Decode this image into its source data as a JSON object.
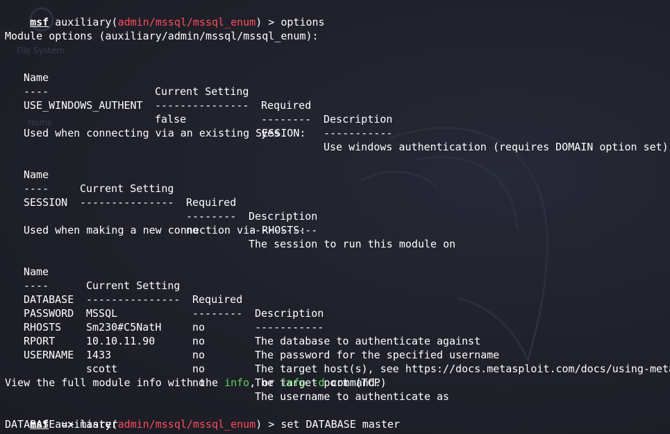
{
  "prompt": {
    "msf": "msf",
    "module_type": "auxiliary",
    "open_paren": "(",
    "module_path": "admin/mssql/mssql_enum",
    "close_paren_arrow": ") >"
  },
  "commands": {
    "first": "options",
    "second": "set DATABASE master"
  },
  "module_options_heading": "Module options (auxiliary/admin/mssql/mssql_enum):",
  "columns": {
    "name": "Name",
    "current": "Current Setting",
    "required": "Required",
    "description": "Description",
    "name_rule": "----",
    "current_rule": "---------------",
    "required_rule": "--------",
    "description_rule": "-----------"
  },
  "module_options": [
    {
      "name": "USE_WINDOWS_AUTHENT",
      "current": "false",
      "required": "yes",
      "description": "Use windows authentication (requires DOMAIN option set)"
    }
  ],
  "session_heading": "Used when connecting via an existing SESSION:",
  "session_options": [
    {
      "name": "SESSION",
      "current": "",
      "required": "no",
      "description": "The session to run this module on"
    }
  ],
  "rhosts_heading": "Used when making a new connection via RHOSTS:",
  "rhosts_options": [
    {
      "name": "DATABASE",
      "current": "MSSQL",
      "required": "no",
      "description": "The database to authenticate against"
    },
    {
      "name": "PASSWORD",
      "current": "Sm230#C5NatH",
      "required": "no",
      "description": "The password for the specified username"
    },
    {
      "name": "RHOSTS",
      "current": "10.10.11.90",
      "required": "no",
      "description": "The target host(s), see https://docs.metasploit.com/docs/using-meta"
    },
    {
      "name": "RPORT",
      "current": "1433",
      "required": "no",
      "description": "The target port (TCP)"
    },
    {
      "name": "USERNAME",
      "current": "scott",
      "required": "no",
      "description": "The username to authenticate as"
    }
  ],
  "footer": {
    "part1": "View the full module info with the ",
    "info": "info",
    "part2": ", or ",
    "info_d": "info -d",
    "part3": " command."
  },
  "result_line": "DATABASE => master",
  "wallpaper": {
    "file_system": "File System",
    "home": "Home"
  },
  "colors": {
    "background": "#1e1f29",
    "prompt_red": "#ff4c5e",
    "keyword_green": "#5fd35f",
    "text": "#ffffff"
  }
}
